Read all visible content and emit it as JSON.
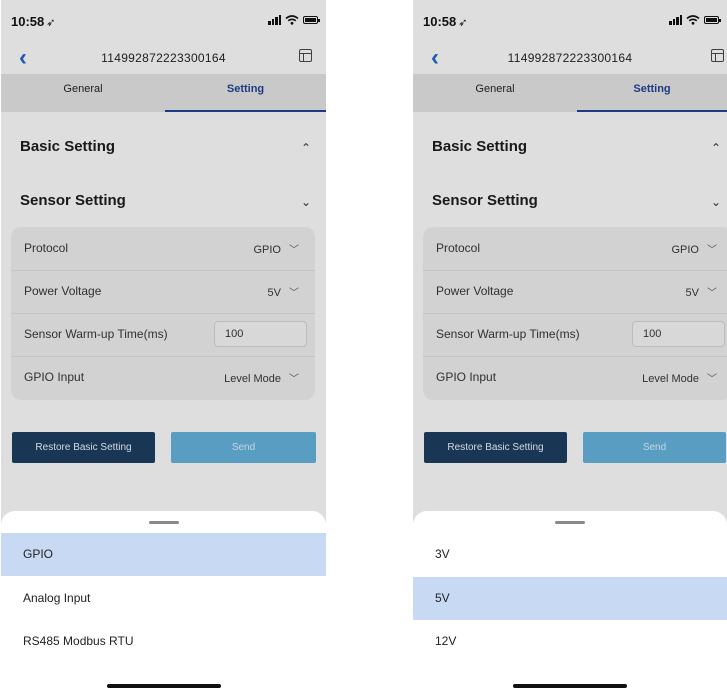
{
  "screens": [
    {
      "status": {
        "time": "10:58",
        "loc": "➶"
      },
      "nav": {
        "title": "114992872223300164"
      },
      "tabs": [
        "General",
        "Setting"
      ],
      "sections": [
        {
          "label": "Basic Setting",
          "chevron": "⌃"
        },
        {
          "label": "Sensor Setting",
          "chevron": "⌄"
        }
      ],
      "rows": [
        {
          "label": "Protocol",
          "value": "GPIO"
        },
        {
          "label": "Power Voltage",
          "value": "5V"
        },
        {
          "label": "Sensor Warm-up Time(ms)",
          "input_value": "100"
        },
        {
          "label": "GPIO Input",
          "value": "Level Mode"
        }
      ],
      "buttons": {
        "restore": "Restore Basic Setting",
        "send": "Send"
      },
      "sheet": {
        "options": [
          "GPIO",
          "Analog Input",
          "RS485 Modbus RTU"
        ],
        "selected": "GPIO"
      }
    },
    {
      "status": {
        "time": "10:58",
        "loc": "➶"
      },
      "nav": {
        "title": "114992872223300164"
      },
      "tabs": [
        "General",
        "Setting"
      ],
      "sections": [
        {
          "label": "Basic Setting",
          "chevron": "⌃"
        },
        {
          "label": "Sensor Setting",
          "chevron": "⌄"
        }
      ],
      "rows": [
        {
          "label": "Protocol",
          "value": "GPIO"
        },
        {
          "label": "Power Voltage",
          "value": "5V"
        },
        {
          "label": "Sensor Warm-up Time(ms)",
          "input_value": "100"
        },
        {
          "label": "GPIO Input",
          "value": "Level Mode"
        }
      ],
      "buttons": {
        "restore": "Restore Basic Setting",
        "send": "Send"
      },
      "sheet": {
        "options": [
          "3V",
          "5V",
          "12V"
        ],
        "selected": "5V"
      }
    }
  ],
  "icons": {
    "back": "chevron-left-icon",
    "menu": "layout-icon",
    "dropdown": "chevron-down-icon"
  },
  "colors": {
    "accent": "#1f5fc4",
    "tab_active": "#1f3f8c",
    "restore_button": "#1b3a5b",
    "send_button": "#5fa7cf",
    "selected_option": "#c7d9f3"
  }
}
